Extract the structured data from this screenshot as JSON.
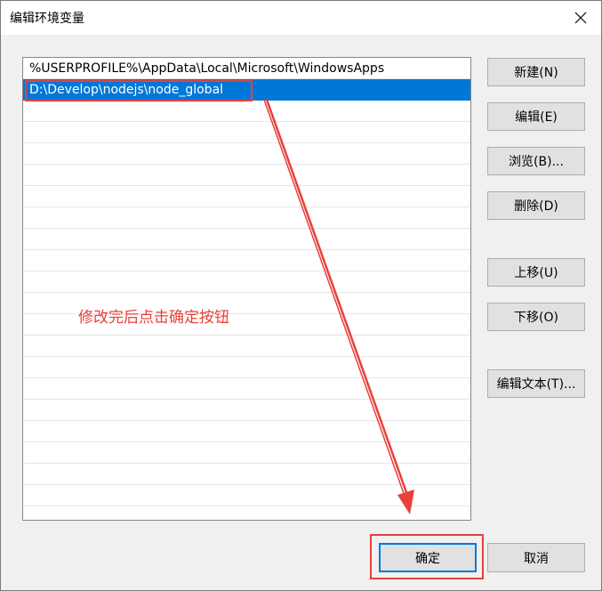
{
  "window": {
    "title": "编辑环境变量"
  },
  "list": {
    "items": [
      "%USERPROFILE%\\AppData\\Local\\Microsoft\\WindowsApps",
      "D:\\Develop\\nodejs\\node_global"
    ],
    "selected_index": 1,
    "empty_rows": 19
  },
  "buttons": {
    "new": "新建(N)",
    "edit": "编辑(E)",
    "browse": "浏览(B)...",
    "delete": "删除(D)",
    "move_up": "上移(U)",
    "move_down": "下移(O)",
    "edit_text": "编辑文本(T)...",
    "ok": "确定",
    "cancel": "取消"
  },
  "annotation": {
    "text": "修改完后点击确定按钮",
    "color": "#e8403a"
  },
  "colors": {
    "selection": "#0078d7",
    "annotation_red": "#e8403a"
  }
}
